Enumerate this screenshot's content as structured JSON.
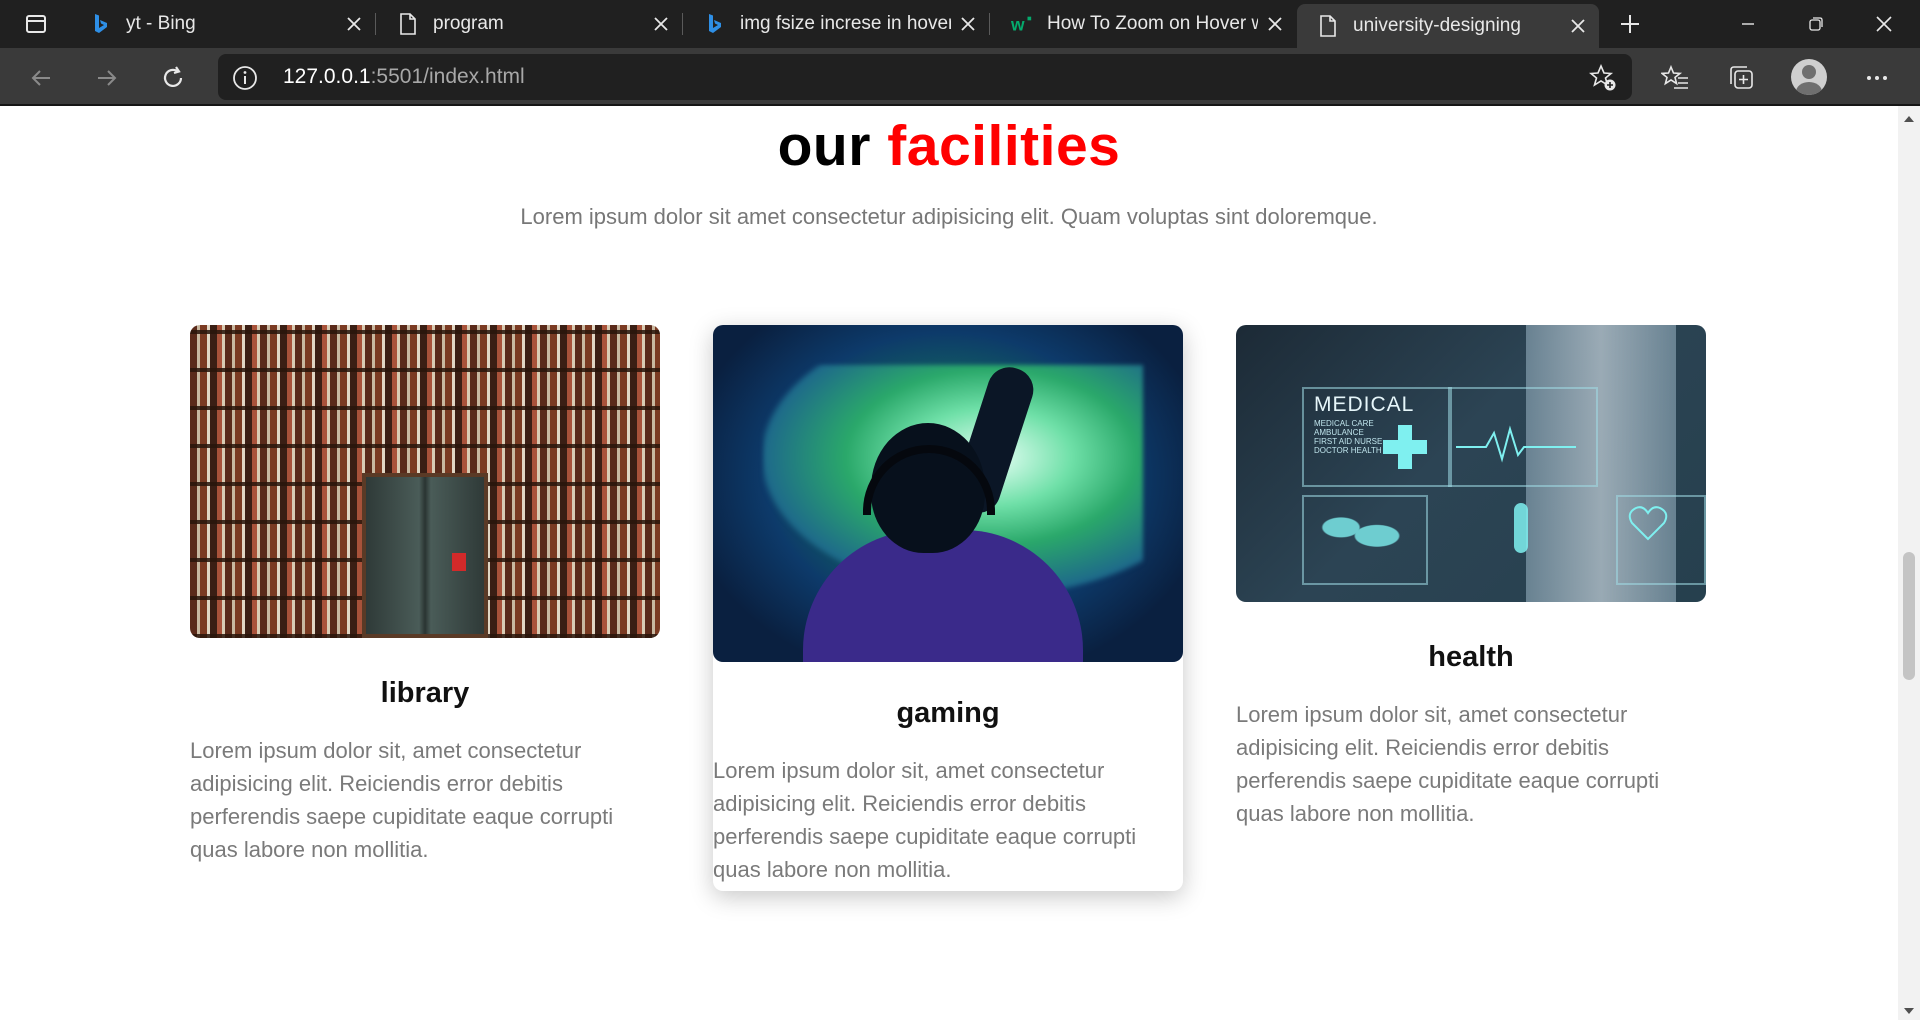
{
  "browser": {
    "tabs": [
      {
        "title": "yt - Bing",
        "favicon": "bing-icon"
      },
      {
        "title": "program",
        "favicon": "page-icon"
      },
      {
        "title": "img fsize increse in hover",
        "favicon": "bing-icon"
      },
      {
        "title": "How To Zoom on Hover w",
        "favicon": "w3schools-icon"
      },
      {
        "title": "university-designing",
        "favicon": "page-icon",
        "active": true
      }
    ],
    "address": {
      "host": "127.0.0.1",
      "port_path": ":5501/index.html"
    }
  },
  "page": {
    "heading": {
      "text": "our",
      "accent": "facilities",
      "accent_color": "#ff0000"
    },
    "subtitle": "Lorem ipsum dolor sit amet consectetur adipisicing elit. Quam voluptas sint doloremque.",
    "cards": [
      {
        "title": "library",
        "image": "library-bookshelf-door-photo",
        "text": "Lorem ipsum dolor sit, amet consectetur adipisicing elit. Reiciendis error debitis perferendis saepe cupiditate eaque corrupti quas labore non mollitia."
      },
      {
        "title": "gaming",
        "image": "gamer-with-headphones-photo",
        "text": "Lorem ipsum dolor sit, amet consectetur adipisicing elit. Reiciendis error debitis perferendis saepe cupiditate eaque corrupti quas labore non mollitia."
      },
      {
        "title": "health",
        "image": "medical-hologram-doctor-photo",
        "image_text": "MEDICAL",
        "image_small_text": "MEDICAL CARE AMBULANCE FIRST AID NURSE DOCTOR HEALTH",
        "text": "Lorem ipsum dolor sit, amet consectetur adipisicing elit. Reiciendis error debitis perferendis saepe cupiditate eaque corrupti quas labore non mollitia."
      }
    ]
  }
}
